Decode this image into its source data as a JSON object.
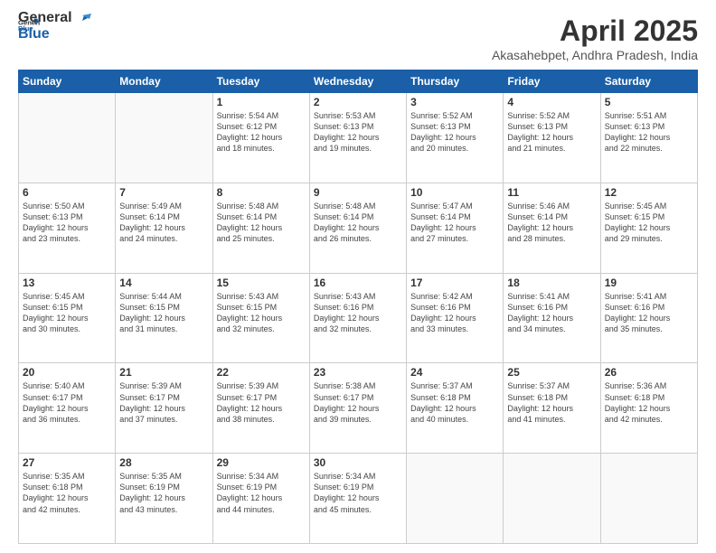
{
  "header": {
    "logo_line1": "General",
    "logo_line2": "Blue",
    "title": "April 2025",
    "subtitle": "Akasahebpet, Andhra Pradesh, India"
  },
  "weekdays": [
    "Sunday",
    "Monday",
    "Tuesday",
    "Wednesday",
    "Thursday",
    "Friday",
    "Saturday"
  ],
  "weeks": [
    [
      {
        "day": "",
        "info": ""
      },
      {
        "day": "",
        "info": ""
      },
      {
        "day": "1",
        "info": "Sunrise: 5:54 AM\nSunset: 6:12 PM\nDaylight: 12 hours\nand 18 minutes."
      },
      {
        "day": "2",
        "info": "Sunrise: 5:53 AM\nSunset: 6:13 PM\nDaylight: 12 hours\nand 19 minutes."
      },
      {
        "day": "3",
        "info": "Sunrise: 5:52 AM\nSunset: 6:13 PM\nDaylight: 12 hours\nand 20 minutes."
      },
      {
        "day": "4",
        "info": "Sunrise: 5:52 AM\nSunset: 6:13 PM\nDaylight: 12 hours\nand 21 minutes."
      },
      {
        "day": "5",
        "info": "Sunrise: 5:51 AM\nSunset: 6:13 PM\nDaylight: 12 hours\nand 22 minutes."
      }
    ],
    [
      {
        "day": "6",
        "info": "Sunrise: 5:50 AM\nSunset: 6:13 PM\nDaylight: 12 hours\nand 23 minutes."
      },
      {
        "day": "7",
        "info": "Sunrise: 5:49 AM\nSunset: 6:14 PM\nDaylight: 12 hours\nand 24 minutes."
      },
      {
        "day": "8",
        "info": "Sunrise: 5:48 AM\nSunset: 6:14 PM\nDaylight: 12 hours\nand 25 minutes."
      },
      {
        "day": "9",
        "info": "Sunrise: 5:48 AM\nSunset: 6:14 PM\nDaylight: 12 hours\nand 26 minutes."
      },
      {
        "day": "10",
        "info": "Sunrise: 5:47 AM\nSunset: 6:14 PM\nDaylight: 12 hours\nand 27 minutes."
      },
      {
        "day": "11",
        "info": "Sunrise: 5:46 AM\nSunset: 6:14 PM\nDaylight: 12 hours\nand 28 minutes."
      },
      {
        "day": "12",
        "info": "Sunrise: 5:45 AM\nSunset: 6:15 PM\nDaylight: 12 hours\nand 29 minutes."
      }
    ],
    [
      {
        "day": "13",
        "info": "Sunrise: 5:45 AM\nSunset: 6:15 PM\nDaylight: 12 hours\nand 30 minutes."
      },
      {
        "day": "14",
        "info": "Sunrise: 5:44 AM\nSunset: 6:15 PM\nDaylight: 12 hours\nand 31 minutes."
      },
      {
        "day": "15",
        "info": "Sunrise: 5:43 AM\nSunset: 6:15 PM\nDaylight: 12 hours\nand 32 minutes."
      },
      {
        "day": "16",
        "info": "Sunrise: 5:43 AM\nSunset: 6:16 PM\nDaylight: 12 hours\nand 32 minutes."
      },
      {
        "day": "17",
        "info": "Sunrise: 5:42 AM\nSunset: 6:16 PM\nDaylight: 12 hours\nand 33 minutes."
      },
      {
        "day": "18",
        "info": "Sunrise: 5:41 AM\nSunset: 6:16 PM\nDaylight: 12 hours\nand 34 minutes."
      },
      {
        "day": "19",
        "info": "Sunrise: 5:41 AM\nSunset: 6:16 PM\nDaylight: 12 hours\nand 35 minutes."
      }
    ],
    [
      {
        "day": "20",
        "info": "Sunrise: 5:40 AM\nSunset: 6:17 PM\nDaylight: 12 hours\nand 36 minutes."
      },
      {
        "day": "21",
        "info": "Sunrise: 5:39 AM\nSunset: 6:17 PM\nDaylight: 12 hours\nand 37 minutes."
      },
      {
        "day": "22",
        "info": "Sunrise: 5:39 AM\nSunset: 6:17 PM\nDaylight: 12 hours\nand 38 minutes."
      },
      {
        "day": "23",
        "info": "Sunrise: 5:38 AM\nSunset: 6:17 PM\nDaylight: 12 hours\nand 39 minutes."
      },
      {
        "day": "24",
        "info": "Sunrise: 5:37 AM\nSunset: 6:18 PM\nDaylight: 12 hours\nand 40 minutes."
      },
      {
        "day": "25",
        "info": "Sunrise: 5:37 AM\nSunset: 6:18 PM\nDaylight: 12 hours\nand 41 minutes."
      },
      {
        "day": "26",
        "info": "Sunrise: 5:36 AM\nSunset: 6:18 PM\nDaylight: 12 hours\nand 42 minutes."
      }
    ],
    [
      {
        "day": "27",
        "info": "Sunrise: 5:35 AM\nSunset: 6:18 PM\nDaylight: 12 hours\nand 42 minutes."
      },
      {
        "day": "28",
        "info": "Sunrise: 5:35 AM\nSunset: 6:19 PM\nDaylight: 12 hours\nand 43 minutes."
      },
      {
        "day": "29",
        "info": "Sunrise: 5:34 AM\nSunset: 6:19 PM\nDaylight: 12 hours\nand 44 minutes."
      },
      {
        "day": "30",
        "info": "Sunrise: 5:34 AM\nSunset: 6:19 PM\nDaylight: 12 hours\nand 45 minutes."
      },
      {
        "day": "",
        "info": ""
      },
      {
        "day": "",
        "info": ""
      },
      {
        "day": "",
        "info": ""
      }
    ]
  ]
}
